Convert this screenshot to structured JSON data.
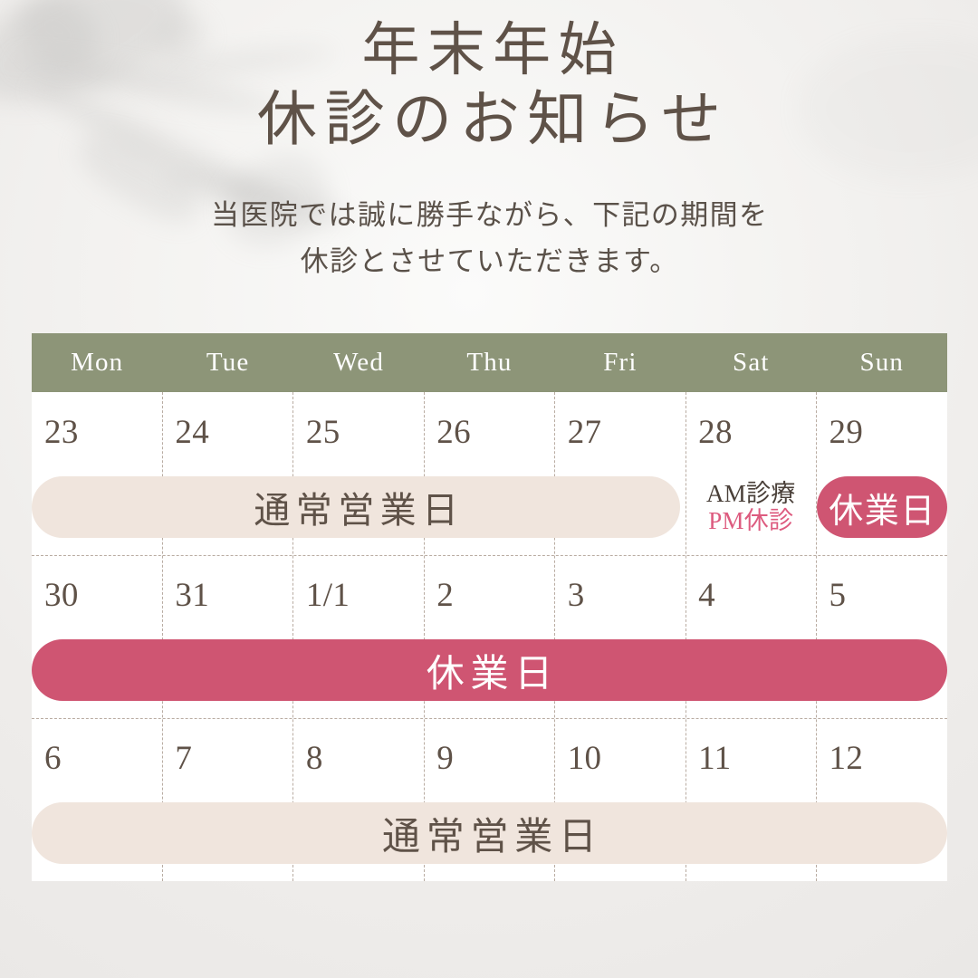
{
  "title": {
    "line1": "年末年始",
    "line2": "休診のお知らせ"
  },
  "subtitle": {
    "line1": "当医院では誠に勝手ながら、下記の期間を",
    "line2": "休診とさせていただきます。"
  },
  "colors": {
    "header_green": "#8d9578",
    "closed_pink": "#cf5572",
    "normal_beige": "#f0e5dd",
    "text_brown": "#5f5248",
    "pm_pink": "#dd5b7f",
    "background": "#f2f1ef"
  },
  "calendar": {
    "weekdays": [
      "Mon",
      "Tue",
      "Wed",
      "Thu",
      "Fri",
      "Sat",
      "Sun"
    ],
    "weeks": [
      {
        "days": [
          "23",
          "24",
          "25",
          "26",
          "27",
          "28",
          "29"
        ],
        "normal_label": "通常営業日",
        "sat_am": "AM診療",
        "sat_pm": "PM休診",
        "sun_label": "休業日"
      },
      {
        "days": [
          "30",
          "31",
          "1/1",
          "2",
          "3",
          "4",
          "5"
        ],
        "banner_label": "休業日"
      },
      {
        "days": [
          "6",
          "7",
          "8",
          "9",
          "10",
          "11",
          "12"
        ],
        "banner_label": "通常営業日"
      }
    ]
  }
}
